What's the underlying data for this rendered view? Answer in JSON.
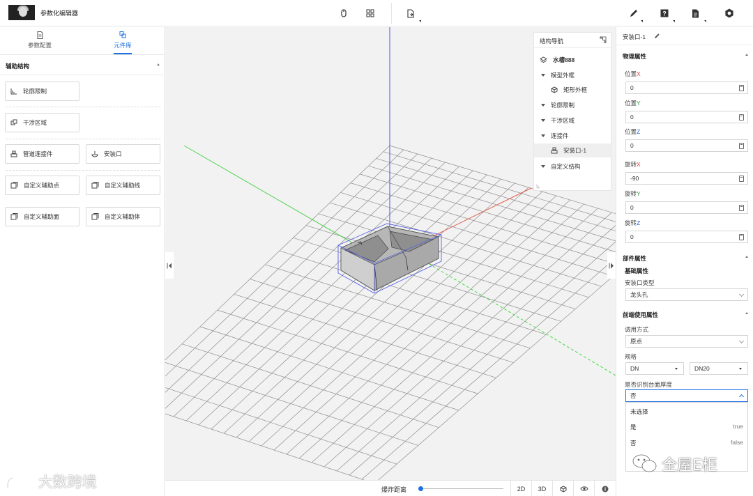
{
  "app": {
    "title": "参数化编辑器"
  },
  "left_panel": {
    "tabs": [
      {
        "label": "参数配置",
        "active": false
      },
      {
        "label": "元件库",
        "active": true
      }
    ],
    "section_title": "辅助结构",
    "buttons": {
      "contour_limit": "轮廓限制",
      "interference_zone": "干涉区域",
      "pipe_connector": "管道连接件",
      "install_port": "安装口",
      "custom_point": "自定义辅助点",
      "custom_line": "自定义辅助线",
      "custom_face": "自定义辅助面",
      "custom_body": "自定义辅助体"
    }
  },
  "structure_nav": {
    "title": "结构导航",
    "items": [
      {
        "label": "水槽888"
      },
      {
        "label": "模型外框"
      },
      {
        "label": "矩形外框"
      },
      {
        "label": "轮廓限制"
      },
      {
        "label": "干涉区域"
      },
      {
        "label": "连接件"
      },
      {
        "label": "安装口-1"
      },
      {
        "label": "自定义结构"
      }
    ]
  },
  "bottom_bar": {
    "explode_label": "爆炸距离",
    "explode_value": 0,
    "view_2d": "2D",
    "view_3d": "3D"
  },
  "right_panel": {
    "header": "安装口-1",
    "physical": {
      "title": "物理属性",
      "fields": [
        {
          "prefix": "位置",
          "axis": "X",
          "value": "0"
        },
        {
          "prefix": "位置",
          "axis": "Y",
          "value": "0"
        },
        {
          "prefix": "位置",
          "axis": "Z",
          "value": "0"
        },
        {
          "prefix": "旋转",
          "axis": "X",
          "value": "-90"
        },
        {
          "prefix": "旋转",
          "axis": "Y",
          "value": "0"
        },
        {
          "prefix": "旋转",
          "axis": "Z",
          "value": "0"
        }
      ]
    },
    "part": {
      "title": "部件属性",
      "basic_title": "基础属性",
      "port_type_label": "安装口类型",
      "port_type_value": "龙头孔"
    },
    "frontend": {
      "title": "前端使用属性",
      "call_mode_label": "调用方式",
      "call_mode_value": "原点",
      "spec_label": "规格",
      "spec_a": "DN",
      "spec_b": "DN20",
      "thickness_label": "是否识别台面厚度",
      "thickness_value": "否",
      "options": [
        {
          "label": "未选择",
          "value": ""
        },
        {
          "label": "是",
          "value": "true"
        },
        {
          "label": "否",
          "value": "false"
        }
      ]
    }
  },
  "watermarks": {
    "left": "大数跨境",
    "right": "全屋E柜"
  },
  "colors": {
    "accent": "#1e6fe0",
    "axis_x": "#e53935",
    "axis_y": "#2e9e3e",
    "axis_z": "#1e5fe0"
  }
}
